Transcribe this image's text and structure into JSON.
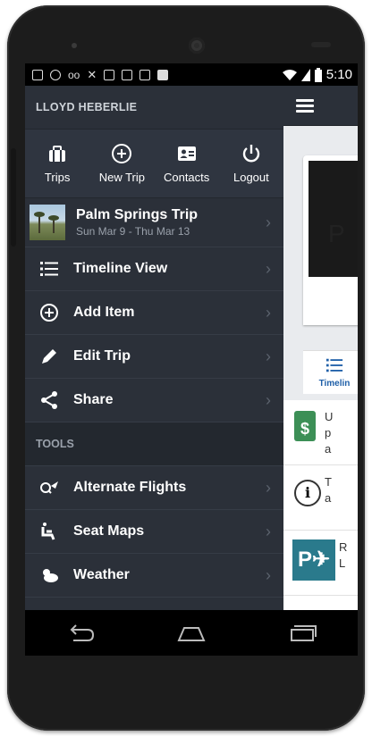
{
  "status_bar": {
    "time": "5:10"
  },
  "drawer": {
    "user_name": "LLOYD HEBERLIE",
    "actions": [
      {
        "label": "Trips",
        "icon": "briefcase-icon"
      },
      {
        "label": "New Trip",
        "icon": "plus-circle-icon"
      },
      {
        "label": "Contacts",
        "icon": "contact-card-icon"
      },
      {
        "label": "Logout",
        "icon": "power-icon"
      }
    ],
    "trip": {
      "name": "Palm Springs Trip",
      "dates": "Sun Mar 9 - Thu Mar 13"
    },
    "trip_menu": [
      {
        "label": "Timeline View",
        "icon": "list-icon"
      },
      {
        "label": "Add Item",
        "icon": "add-circle-icon"
      },
      {
        "label": "Edit Trip",
        "icon": "pencil-icon"
      },
      {
        "label": "Share",
        "icon": "share-icon"
      }
    ],
    "tools_header": "TOOLS",
    "tools": [
      {
        "label": "Alternate Flights",
        "icon": "flight-search-icon"
      },
      {
        "label": "Seat Maps",
        "icon": "seat-icon"
      },
      {
        "label": "Weather",
        "icon": "weather-icon"
      }
    ]
  },
  "main": {
    "card_letter": "P",
    "timeline_tab": "Timelin",
    "list_items": [
      {
        "text": "U\np\na",
        "icon": "price-tag-icon"
      },
      {
        "text": "T\na",
        "icon": "info-icon"
      },
      {
        "text": "R\nL",
        "icon": "parking-icon"
      }
    ]
  },
  "colors": {
    "drawer_bg": "#2b3039",
    "accent_blue": "#1e5fa8",
    "parking_teal": "#2a7a8c",
    "tag_green": "#3c8f56"
  }
}
